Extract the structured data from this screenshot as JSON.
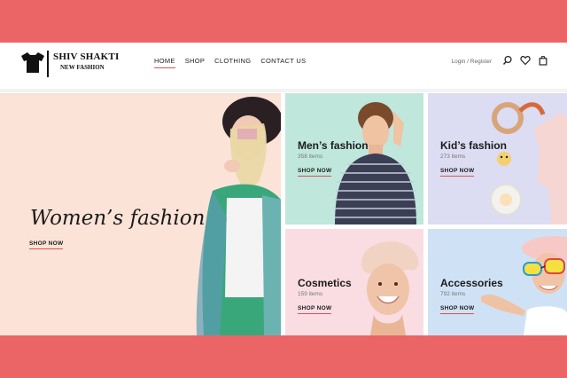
{
  "brand": {
    "name": "SHIV SHAKTI",
    "tagline": "NEW FASHION"
  },
  "nav": [
    "HOME",
    "SHOP",
    "CLOTHING",
    "CONTACT US"
  ],
  "header": {
    "login": "Login / Register",
    "icons": [
      "search-icon",
      "heart-icon",
      "bag-icon"
    ]
  },
  "tiles": {
    "women": {
      "title": "Women’s fashion",
      "cta": "SHOP NOW"
    },
    "men": {
      "title": "Men’s fashion",
      "count": "358 items",
      "cta": "SHOP NOW"
    },
    "kid": {
      "title": "Kid’s fashion",
      "count": "273 items",
      "cta": "SHOP NOW"
    },
    "cosmetics": {
      "title": "Cosmetics",
      "count": "159 items",
      "cta": "SHOP NOW"
    },
    "accessories": {
      "title": "Accessories",
      "count": "792 items",
      "cta": "SHOP NOW"
    }
  },
  "colors": {
    "page_band": "#ec6566",
    "accent": "#d9534f",
    "women_bg": "#fbe3d7",
    "men_bg": "#bfe7dc",
    "kid_bg": "#dcdcf3",
    "cosmetics_bg": "#f9dde3",
    "accessories_bg": "#cfe2f5"
  }
}
